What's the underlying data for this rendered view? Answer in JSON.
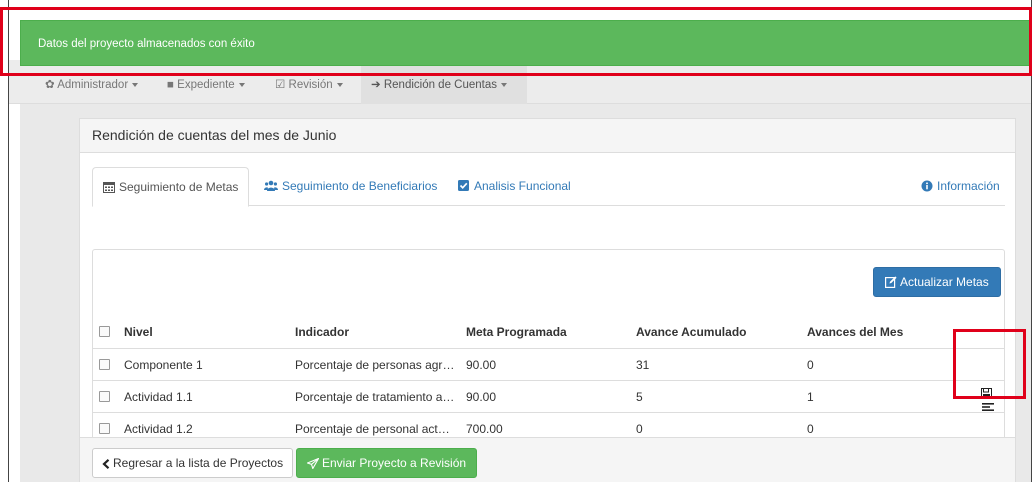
{
  "alert": {
    "message": "Datos del proyecto almacenados con éxito"
  },
  "navbar": {
    "items": [
      {
        "label": "Administrador"
      },
      {
        "label": "Expediente"
      },
      {
        "label": "Revisión"
      },
      {
        "label": "Rendición de Cuentas"
      }
    ]
  },
  "panel": {
    "title": "Rendición de cuentas del mes de Junio"
  },
  "tabs": [
    {
      "label": "Seguimiento de Metas",
      "icon": "calendar-icon"
    },
    {
      "label": "Seguimiento de Beneficiarios",
      "icon": "users-icon"
    },
    {
      "label": "Analisis Funcional",
      "icon": "checkbox-icon"
    },
    {
      "label": "Información",
      "icon": "info-circle-icon"
    }
  ],
  "actions": {
    "update_label": "Actualizar Metas"
  },
  "table": {
    "columns": [
      "Nivel",
      "Indicador",
      "Meta Programada",
      "Avance Acumulado",
      "Avances del Mes"
    ],
    "rows": [
      {
        "nivel": "Componente 1",
        "indicador": "Porcentaje de personas agregadas",
        "meta": "90.00",
        "acumulado": "31",
        "mes": "0"
      },
      {
        "nivel": "Actividad 1.1",
        "indicador": "Porcentaje de tratamiento aplicado",
        "meta": "90.00",
        "acumulado": "5",
        "mes": "1"
      },
      {
        "nivel": "Actividad 1.2",
        "indicador": "Porcentaje de personal actualizado",
        "meta": "700.00",
        "acumulado": "0",
        "mes": "0"
      }
    ]
  },
  "footer": {
    "back_label": "Regresar a la lista de Proyectos",
    "send_label": "Enviar Proyecto a Revisión"
  },
  "colors": {
    "success": "#5cb85c",
    "primary": "#337ab7",
    "highlight": "#e0001a"
  }
}
